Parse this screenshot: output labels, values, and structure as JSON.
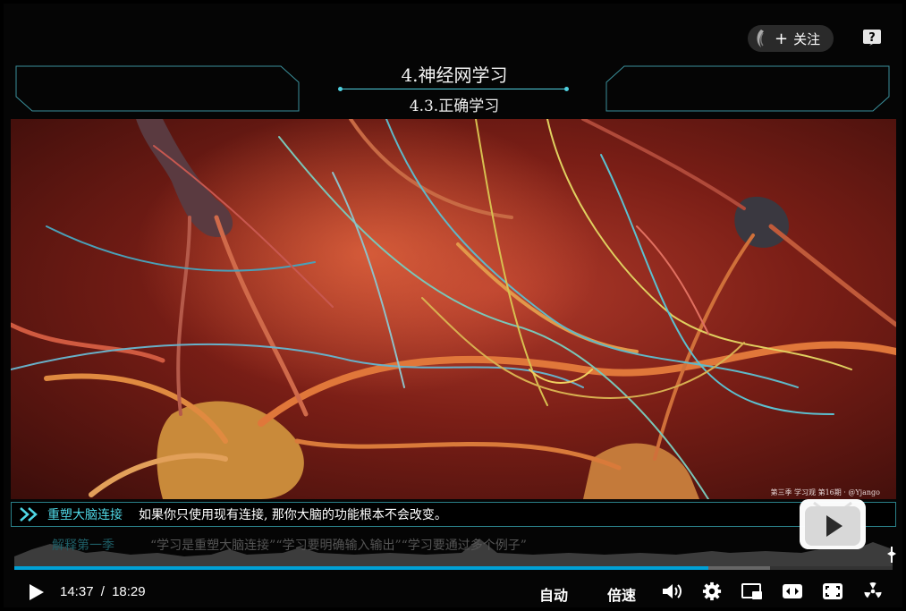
{
  "header": {
    "follow_label": "关注",
    "title": "4.神经网学习",
    "subtitle": "4.3.正确学习"
  },
  "video": {
    "watermark": "第三季 学习观 第16期 · @Yjango"
  },
  "subtitle_bar": {
    "chapter": "重塑大脑连接",
    "text": "如果你只使用现有连接, 那你大脑的功能根本不会改变。"
  },
  "description": {
    "season": "解释第一季",
    "points": "“学习是重塑大脑连接”“学习要明确输入输出”“学习要通过多个例子”"
  },
  "player": {
    "current_time": "14:37",
    "separator": "/",
    "duration": "18:29",
    "progress": 0.79,
    "buffered": 0.86,
    "auto_label": "自动",
    "speed_label": "倍速"
  },
  "colors": {
    "accent": "#4fd6e4",
    "progress": "#00a1d6"
  },
  "icons": [
    "avatar-icon",
    "help-icon",
    "chevron-icon",
    "play-icon",
    "volume-icon",
    "settings-icon",
    "pip-icon",
    "widescreen-icon",
    "fullscreen-icon",
    "radiation-icon"
  ]
}
